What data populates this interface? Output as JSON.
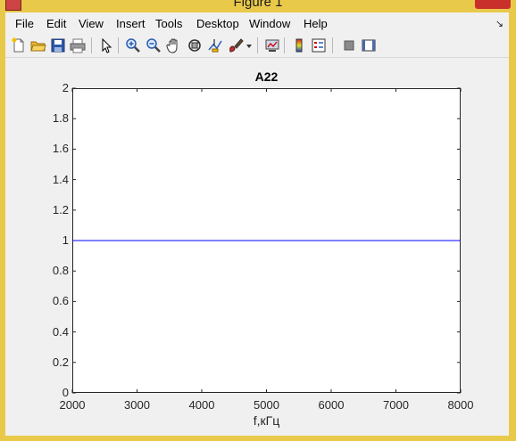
{
  "window": {
    "title": "Figure 1"
  },
  "menu": {
    "items": [
      "File",
      "Edit",
      "View",
      "Insert",
      "Tools",
      "Desktop",
      "Window",
      "Help"
    ]
  },
  "toolbar": {
    "buttons": [
      "new-figure-icon",
      "open-file-icon",
      "save-icon",
      "print-icon",
      "select-arrow-icon",
      "zoom-in-icon",
      "zoom-out-icon",
      "pan-hand-icon",
      "rotate-3d-icon",
      "data-cursor-icon",
      "brush-icon",
      "link-plot-icon",
      "insert-colorbar-icon",
      "insert-legend-icon",
      "hide-plot-tools-icon",
      "show-plot-tools-icon"
    ]
  },
  "chart_data": {
    "type": "line",
    "title": "A22",
    "xlabel": "f,кГц",
    "ylabel": "",
    "xlim": [
      2000,
      8000
    ],
    "ylim": [
      0,
      2
    ],
    "xticks": [
      "2000",
      "3000",
      "4000",
      "5000",
      "6000",
      "7000",
      "8000"
    ],
    "yticks": [
      "0",
      "0.2",
      "0.4",
      "0.6",
      "0.8",
      "1",
      "1.2",
      "1.4",
      "1.6",
      "1.8",
      "2"
    ],
    "grid": false,
    "series": [
      {
        "x": [
          2000,
          8000
        ],
        "y": [
          1,
          1
        ],
        "color": "#0000ff"
      }
    ]
  }
}
